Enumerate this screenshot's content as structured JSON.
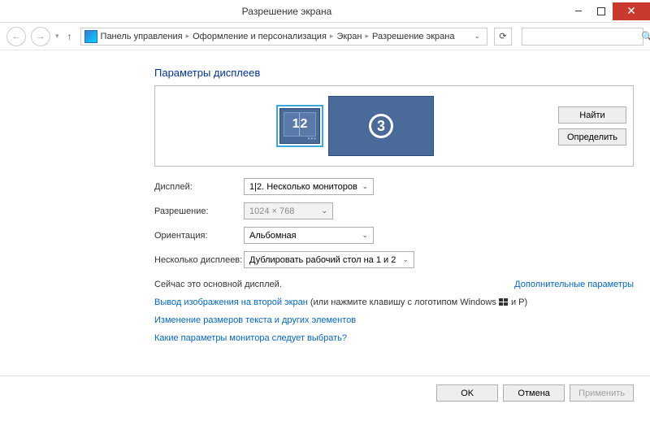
{
  "window": {
    "title": "Разрешение экрана"
  },
  "breadcrumbs": {
    "root": "Панель управления",
    "cat": "Оформление и персонализация",
    "sub": "Экран",
    "leaf": "Разрешение экрана"
  },
  "heading": "Параметры дисплеев",
  "monitors": {
    "label12_a": "1",
    "label12_b": "2",
    "label3": "3"
  },
  "buttons": {
    "find": "Найти",
    "detect": "Определить",
    "ok": "OK",
    "cancel": "Отмена",
    "apply": "Применить"
  },
  "labels": {
    "display": "Дисплей:",
    "resolution": "Разрешение:",
    "orientation": "Ориентация:",
    "multi": "Несколько дисплеев:"
  },
  "values": {
    "display": "1|2. Несколько мониторов",
    "resolution": "1024 × 768",
    "orientation": "Альбомная",
    "multi": "Дублировать рабочий стол на 1 и 2"
  },
  "info": {
    "primary": "Сейчас это основной дисплей.",
    "advanced": "Дополнительные параметры"
  },
  "links": {
    "project_link": "Вывод изображения на второй экран",
    "project_rest": " (или нажмите клавишу с логотипом Windows ",
    "project_tail": " и P)",
    "textsize": "Изменение размеров текста и других элементов",
    "which": "Какие параметры монитора следует выбрать?"
  }
}
